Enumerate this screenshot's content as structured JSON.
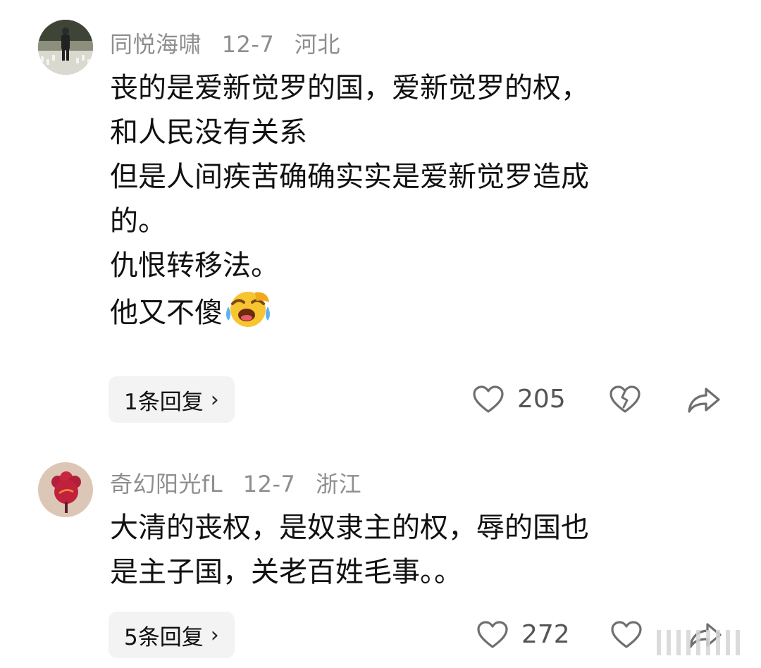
{
  "comments": [
    {
      "username": "同悦海啸",
      "date": "12-7",
      "location": "河北",
      "lines": [
        "丧的是爱新觉罗的国，爱新觉罗的权，",
        "和人民没有关系",
        "但是人间疾苦确确实实是爱新觉罗造成",
        "的。",
        "仇恨转移法。",
        "他又不傻"
      ],
      "emoji": "laughing-crying-emoji",
      "reply_label": "1条回复",
      "likes": "205",
      "avatar": "stadium-figure-avatar"
    },
    {
      "username": "奇幻阳光fL",
      "date": "12-7",
      "location": "浙江",
      "lines": [
        "大清的丧权，是奴隶主的权，辱的国也",
        "是主子国，关老百姓毛事。。"
      ],
      "reply_label": "5条回复",
      "likes": "272",
      "avatar": "red-flower-avatar"
    }
  ],
  "colors": {
    "meta": "#8e8e8e",
    "reply_bg": "#f3f3f3",
    "icon": "#6f6f6f"
  }
}
